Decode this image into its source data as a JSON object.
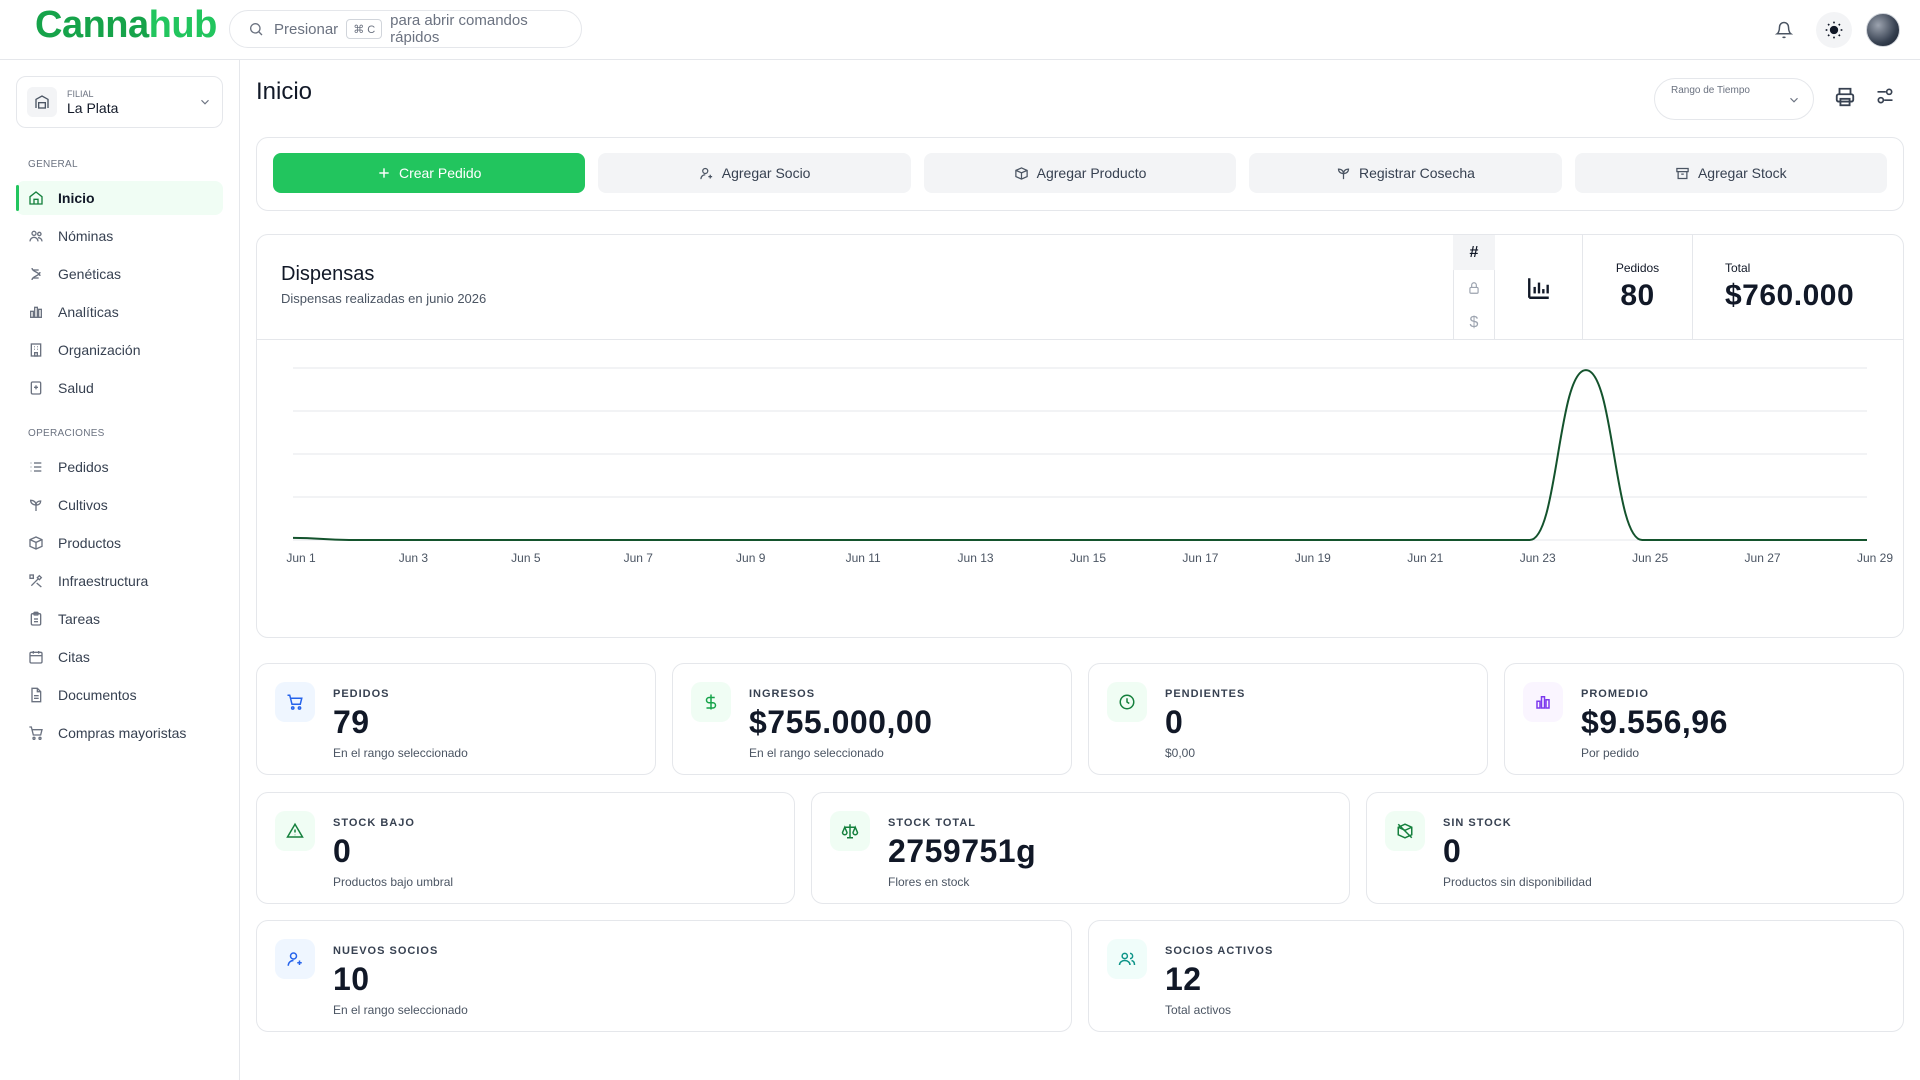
{
  "header": {
    "logo_part1": "Canna",
    "logo_part2": "hub",
    "search_prefix": "Presionar",
    "search_kbd": "⌘ C",
    "search_suffix": "para abrir comandos rápidos"
  },
  "sidebar": {
    "branch": {
      "label": "FILIAL",
      "name": "La Plata"
    },
    "sections": [
      {
        "title": "GENERAL",
        "items": [
          {
            "label": "Inicio",
            "icon": "home-icon",
            "active": true
          },
          {
            "label": "Nóminas",
            "icon": "users-icon"
          },
          {
            "label": "Genéticas",
            "icon": "dna-icon"
          },
          {
            "label": "Analíticas",
            "icon": "bar-chart-icon"
          },
          {
            "label": "Organización",
            "icon": "building-icon"
          },
          {
            "label": "Salud",
            "icon": "health-icon"
          }
        ]
      },
      {
        "title": "OPERACIONES",
        "items": [
          {
            "label": "Pedidos",
            "icon": "list-icon"
          },
          {
            "label": "Cultivos",
            "icon": "sprout-icon"
          },
          {
            "label": "Productos",
            "icon": "box-icon"
          },
          {
            "label": "Infraestructura",
            "icon": "tools-icon"
          },
          {
            "label": "Tareas",
            "icon": "clipboard-icon"
          },
          {
            "label": "Citas",
            "icon": "calendar-icon"
          },
          {
            "label": "Documentos",
            "icon": "file-icon"
          },
          {
            "label": "Compras mayoristas",
            "icon": "cart-icon"
          }
        ]
      }
    ]
  },
  "main": {
    "title": "Inicio",
    "range_label": "Rango de Tiempo",
    "actions": [
      {
        "label": "Crear Pedido",
        "icon": "plus-icon",
        "primary": true
      },
      {
        "label": "Agregar Socio",
        "icon": "user-plus-icon"
      },
      {
        "label": "Agregar Producto",
        "icon": "package-icon"
      },
      {
        "label": "Registrar Cosecha",
        "icon": "harvest-icon"
      },
      {
        "label": "Agregar Stock",
        "icon": "archive-icon"
      }
    ]
  },
  "dispensas": {
    "title": "Dispensas",
    "subtitle": "Dispensas realizadas en junio 2026",
    "toggles": [
      "#",
      "lock-icon",
      "$"
    ],
    "pedidos_label": "Pedidos",
    "pedidos_value": "80",
    "total_label": "Total",
    "total_value": "$760.000"
  },
  "chart_data": {
    "type": "line",
    "x": [
      "Jun 1",
      "Jun 2",
      "Jun 3",
      "Jun 4",
      "Jun 5",
      "Jun 6",
      "Jun 7",
      "Jun 8",
      "Jun 9",
      "Jun 10",
      "Jun 11",
      "Jun 12",
      "Jun 13",
      "Jun 14",
      "Jun 15",
      "Jun 16",
      "Jun 17",
      "Jun 18",
      "Jun 19",
      "Jun 20",
      "Jun 21",
      "Jun 22",
      "Jun 23",
      "Jun 24",
      "Jun 25",
      "Jun 26",
      "Jun 27",
      "Jun 28",
      "Jun 29"
    ],
    "series": [
      {
        "values": [
          1,
          0,
          0,
          0,
          0,
          0,
          0,
          0,
          0,
          0,
          0,
          0,
          0,
          0,
          0,
          0,
          0,
          0,
          0,
          0,
          0,
          0,
          0,
          79,
          0,
          0,
          0,
          0,
          0
        ]
      }
    ],
    "tick_labels": [
      "Jun 1",
      "Jun 3",
      "Jun 5",
      "Jun 7",
      "Jun 9",
      "Jun 11",
      "Jun 13",
      "Jun 15",
      "Jun 17",
      "Jun 19",
      "Jun 21",
      "Jun 23",
      "Jun 25",
      "Jun 27",
      "Jun 29"
    ],
    "ylim": [
      0,
      80
    ],
    "grid": true,
    "color": "#14532d"
  },
  "metrics": [
    {
      "title": "PEDIDOS",
      "value": "79",
      "caption": "En el rango seleccionado",
      "icon": "cart-icon",
      "color": "#2563eb"
    },
    {
      "title": "INGRESOS",
      "value": "$755.000,00",
      "caption": "En el rango seleccionado",
      "icon": "dollar-icon",
      "color": "#16a34a"
    },
    {
      "title": "PENDIENTES",
      "value": "0",
      "caption": "$0,00",
      "icon": "clock-icon",
      "color": "#15803d"
    },
    {
      "title": "PROMEDIO",
      "value": "$9.556,96",
      "caption": "Por pedido",
      "icon": "chart-icon",
      "color": "#7c3aed"
    },
    {
      "title": "STOCK BAJO",
      "value": "0",
      "caption": "Productos bajo umbral",
      "icon": "warning-icon",
      "color": "#15803d"
    },
    {
      "title": "STOCK TOTAL",
      "value": "2759751g",
      "caption": "Flores en stock",
      "icon": "scale-icon",
      "color": "#15803d"
    },
    {
      "title": "SIN STOCK",
      "value": "0",
      "caption": "Productos sin disponibilidad",
      "icon": "package-off-icon",
      "color": "#15803d"
    },
    {
      "title": "NUEVOS SOCIOS",
      "value": "10",
      "caption": "En el rango seleccionado",
      "icon": "user-plus-icon",
      "color": "#2563eb"
    },
    {
      "title": "SOCIOS ACTIVOS",
      "value": "12",
      "caption": "Total activos",
      "icon": "users-icon",
      "color": "#0d9488"
    }
  ]
}
